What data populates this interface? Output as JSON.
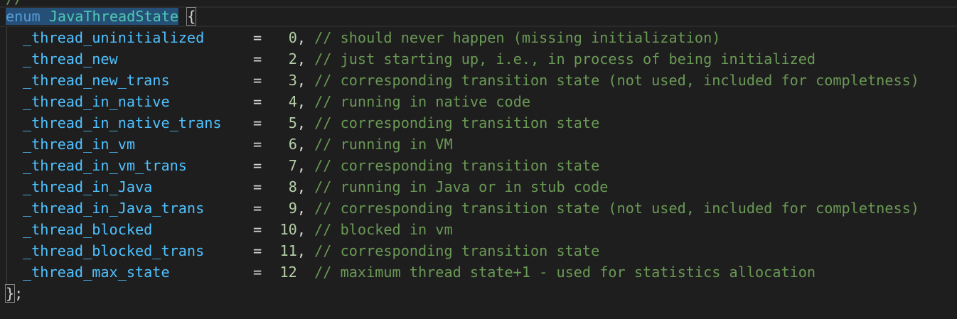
{
  "editor": {
    "prev_line": "//",
    "header": {
      "keyword": "enum",
      "name": "JavaThreadState",
      "open_brace": "{"
    },
    "members": [
      {
        "name": "_thread_uninitialized",
        "eq": "=",
        "value": "0,",
        "comment": "// should never happen (missing initialization)"
      },
      {
        "name": "_thread_new",
        "eq": "=",
        "value": "2,",
        "comment": "// just starting up, i.e., in process of being initialized"
      },
      {
        "name": "_thread_new_trans",
        "eq": "=",
        "value": "3,",
        "comment": "// corresponding transition state (not used, included for completness)"
      },
      {
        "name": "_thread_in_native",
        "eq": "=",
        "value": "4,",
        "comment": "// running in native code"
      },
      {
        "name": "_thread_in_native_trans",
        "eq": "=",
        "value": "5,",
        "comment": "// corresponding transition state"
      },
      {
        "name": "_thread_in_vm",
        "eq": "=",
        "value": "6,",
        "comment": "// running in VM"
      },
      {
        "name": "_thread_in_vm_trans",
        "eq": "=",
        "value": "7,",
        "comment": "// corresponding transition state"
      },
      {
        "name": "_thread_in_Java",
        "eq": "=",
        "value": "8,",
        "comment": "// running in Java or in stub code"
      },
      {
        "name": "_thread_in_Java_trans",
        "eq": "=",
        "value": "9,",
        "comment": "// corresponding transition state (not used, included for completness)"
      },
      {
        "name": "_thread_blocked",
        "eq": "=",
        "value": "10,",
        "comment": "// blocked in vm"
      },
      {
        "name": "_thread_blocked_trans",
        "eq": "=",
        "value": "11,",
        "comment": "// corresponding transition state"
      },
      {
        "name": "_thread_max_state",
        "eq": "=",
        "value": "12 ",
        "comment": "// maximum thread state+1 - used for statistics allocation"
      }
    ],
    "closing": {
      "brace": "}",
      "semicolon": ";"
    },
    "colors": {
      "background": "#1e1e1e",
      "keyword": "#569cd6",
      "type": "#4ec9b0",
      "variable": "#4fc1ff",
      "number": "#b5cea8",
      "comment": "#6a9955",
      "selection": "#264f78"
    }
  }
}
